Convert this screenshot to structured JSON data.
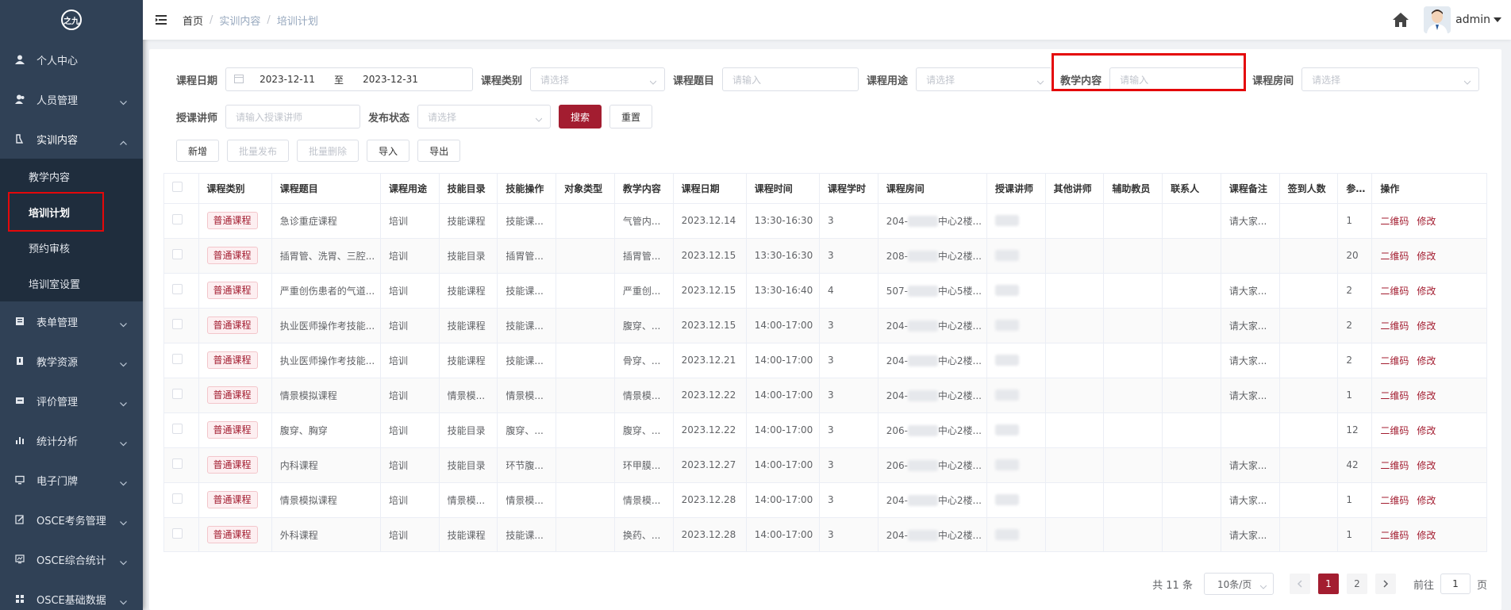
{
  "sidebar": {
    "logo": "之九",
    "menu": [
      {
        "label": "个人中心",
        "icon": "user-icon",
        "arrow": false
      },
      {
        "label": "人员管理",
        "icon": "users-icon",
        "arrow": true
      },
      {
        "label": "实训内容",
        "icon": "flask-icon",
        "arrow": true,
        "open": true,
        "children": [
          "教学内容",
          "培训计划",
          "预约审核",
          "培训室设置"
        ]
      },
      {
        "label": "表单管理",
        "icon": "form-icon",
        "arrow": true
      },
      {
        "label": "教学资源",
        "icon": "book-icon",
        "arrow": true
      },
      {
        "label": "评价管理",
        "icon": "rating-icon",
        "arrow": true
      },
      {
        "label": "统计分析",
        "icon": "bar-chart-icon",
        "arrow": true
      },
      {
        "label": "电子门牌",
        "icon": "monitor-icon",
        "arrow": true
      },
      {
        "label": "OSCE考务管理",
        "icon": "edit-icon",
        "arrow": true
      },
      {
        "label": "OSCE综合统计",
        "icon": "stats-screen-icon",
        "arrow": true
      },
      {
        "label": "OSCE基础数据",
        "icon": "grid-icon",
        "arrow": true
      }
    ]
  },
  "navbar": {
    "breadcrumb": [
      "首页",
      "实训内容",
      "培训计划"
    ],
    "username": "admin"
  },
  "filters": {
    "date_label": "课程日期",
    "date_start": "2023-12-11",
    "date_sep": "至",
    "date_end": "2023-12-31",
    "category_label": "课程类别",
    "category_placeholder": "请选择",
    "topic_label": "课程题目",
    "topic_placeholder": "请输入",
    "purpose_label": "课程用途",
    "purpose_placeholder": "请选择",
    "content_label": "教学内容",
    "content_placeholder": "请输入",
    "room_label": "课程房间",
    "room_placeholder": "请选择",
    "teacher_label": "授课讲师",
    "teacher_placeholder": "请输入授课讲师",
    "status_label": "发布状态",
    "status_placeholder": "请选择",
    "search_btn": "搜索",
    "reset_btn": "重置"
  },
  "toolbar": {
    "add": "新增",
    "batch_publish": "批量发布",
    "batch_delete": "批量删除",
    "import": "导入",
    "export": "导出"
  },
  "table": {
    "headers": [
      "课程类别",
      "课程题目",
      "课程用途",
      "技能目录",
      "技能操作",
      "对象类型",
      "教学内容",
      "课程日期",
      "课程时间",
      "课程学时",
      "课程房间",
      "授课讲师",
      "其他讲师",
      "辅助教员",
      "联系人",
      "课程备注",
      "签到人数",
      "参加人",
      "操作"
    ],
    "op_qrcode": "二维码",
    "op_edit": "修改",
    "rows": [
      {
        "cat": "普通课程",
        "topic": "急诊重症课程",
        "use": "培训",
        "dir": "技能课程",
        "skill": "技能课...",
        "content": "气管内...",
        "date": "2023.12.14",
        "time": "13:30-16:30",
        "hours": "3",
        "room_a": "204-",
        "room_b": "中心2楼...",
        "remark": "请大家...",
        "join": "1"
      },
      {
        "cat": "普通课程",
        "topic": "插胃管、洗胃、三腔...",
        "use": "培训",
        "dir": "技能目录",
        "skill": "插胃管...",
        "content": "插胃管...",
        "date": "2023.12.15",
        "time": "13:30-16:30",
        "hours": "3",
        "room_a": "208-",
        "room_b": "中心2楼...",
        "remark": "",
        "join": "20"
      },
      {
        "cat": "普通课程",
        "topic": "严重创伤患者的气道...",
        "use": "培训",
        "dir": "技能课程",
        "skill": "技能课...",
        "content": "严重创...",
        "date": "2023.12.15",
        "time": "13:30-16:40",
        "hours": "4",
        "room_a": "507-",
        "room_b": "中心5楼...",
        "remark": "请大家...",
        "join": "2"
      },
      {
        "cat": "普通课程",
        "topic": "执业医师操作考技能...",
        "use": "培训",
        "dir": "技能课程",
        "skill": "技能课...",
        "content": "腹穿、...",
        "date": "2023.12.15",
        "time": "14:00-17:00",
        "hours": "3",
        "room_a": "204-",
        "room_b": "中心2楼...",
        "remark": "请大家...",
        "join": "2"
      },
      {
        "cat": "普通课程",
        "topic": "执业医师操作考技能...",
        "use": "培训",
        "dir": "技能课程",
        "skill": "技能课...",
        "content": "骨穿、...",
        "date": "2023.12.21",
        "time": "14:00-17:00",
        "hours": "3",
        "room_a": "204-",
        "room_b": "中心2楼...",
        "remark": "请大家...",
        "join": "2"
      },
      {
        "cat": "普通课程",
        "topic": "情景模拟课程",
        "use": "培训",
        "dir": "情景模...",
        "skill": "情景模...",
        "content": "情景模...",
        "date": "2023.12.22",
        "time": "14:00-17:00",
        "hours": "3",
        "room_a": "204-",
        "room_b": "中心2楼...",
        "remark": "请大家...",
        "join": "1"
      },
      {
        "cat": "普通课程",
        "topic": "腹穿、胸穿",
        "use": "培训",
        "dir": "技能目录",
        "skill": "腹穿、...",
        "content": "腹穿、...",
        "date": "2023.12.22",
        "time": "14:00-17:00",
        "hours": "3",
        "room_a": "206-",
        "room_b": "中心2楼...",
        "remark": "",
        "join": "12"
      },
      {
        "cat": "普通课程",
        "topic": "内科课程",
        "use": "培训",
        "dir": "技能目录",
        "skill": "环节腹...",
        "content": "环甲膜...",
        "date": "2023.12.27",
        "time": "14:00-17:00",
        "hours": "3",
        "room_a": "206-",
        "room_b": "中心2楼...",
        "remark": "请大家...",
        "join": "42"
      },
      {
        "cat": "普通课程",
        "topic": "情景模拟课程",
        "use": "培训",
        "dir": "情景模...",
        "skill": "情景模...",
        "content": "情景模...",
        "date": "2023.12.28",
        "time": "14:00-17:00",
        "hours": "3",
        "room_a": "204-",
        "room_b": "中心2楼...",
        "remark": "请大家...",
        "join": "1"
      },
      {
        "cat": "普通课程",
        "topic": "外科课程",
        "use": "培训",
        "dir": "技能课程",
        "skill": "技能课...",
        "content": "换药、...",
        "date": "2023.12.28",
        "time": "14:00-17:00",
        "hours": "3",
        "room_a": "204-",
        "room_b": "中心2楼...",
        "remark": "请大家...",
        "join": "1"
      }
    ]
  },
  "pagination": {
    "total": "共 11 条",
    "page_size": "10条/页",
    "pages": [
      "1",
      "2"
    ],
    "current": "1",
    "goto_label": "前往",
    "goto_value": "1",
    "page_suffix": "页"
  },
  "colors": {
    "accent": "#a31d30",
    "sidebar": "#304156",
    "highlight": "#e4080a"
  }
}
